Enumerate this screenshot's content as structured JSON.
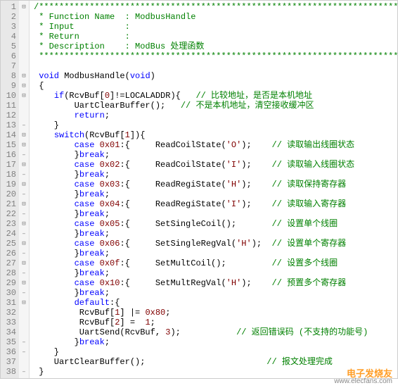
{
  "domain": "Computer-Use",
  "watermark": {
    "line1": "电子发烧友",
    "line2": "www.elecfans.com"
  },
  "line_numbers": {
    "start": 1,
    "end": 38
  },
  "fold_markers": {
    "1": "⊟",
    "8": "⊟",
    "9": "⊟",
    "10": "⊟",
    "13": "–",
    "14": "⊟",
    "15": "⊟",
    "16": "–",
    "17": "⊟",
    "18": "–",
    "19": "⊟",
    "20": "–",
    "21": "⊟",
    "22": "–",
    "23": "⊟",
    "24": "–",
    "25": "⊟",
    "26": "–",
    "27": "⊟",
    "28": "–",
    "29": "⊟",
    "30": "–",
    "31": "⊟",
    "35": "–",
    "36": "–",
    "38": "–"
  },
  "code": {
    "l1": "/****************************************************************************",
    "l2": " * Function Name  : ModbusHandle",
    "l3": " * Input          :",
    "l4": " * Return         :",
    "l5": " * Description    : ModBus 处理函数",
    "l6": " ***************************************************************************/",
    "l7": "",
    "l8_kw1": "void",
    "l8_name": " ModbusHandle(",
    "l8_kw2": "void",
    "l8_close": ")",
    "l9": "{",
    "l10_kw": "if",
    "l10_expr": "(RcvBuf[",
    "l10_n": "0",
    "l10_rest": "]!=LOCALADDR){   ",
    "l10_cmt": "// 比较地址，是否是本机地址",
    "l11_txt": "        UartClearBuffer();   ",
    "l11_cmt": "// 不是本机地址，清空接收缓冲区",
    "l12_kw": "return",
    "l12_rest": ";",
    "l13": "    }",
    "l14_kw": "switch",
    "l14_expr": "(RcvBuf[",
    "l14_n": "1",
    "l14_close": "]){",
    "l15_kw": "case",
    "l15_v": " 0x01",
    "l15_col": ":{     ReadCoilState(",
    "l15_s": "'O'",
    "l15_end": ");    ",
    "l15_cmt": "// 读取输出线圈状态",
    "l16_br": "break",
    "l16_txt": "        }",
    "l16_end": ";",
    "l17_kw": "case",
    "l17_v": " 0x02",
    "l17_col": ":{     ReadCoilState(",
    "l17_s": "'I'",
    "l17_end": ");    ",
    "l17_cmt": "// 读取输入线圈状态",
    "l18_br": "break",
    "l18_txt": "        }",
    "l18_end": ";",
    "l19_kw": "case",
    "l19_v": " 0x03",
    "l19_col": ":{     ReadRegiState(",
    "l19_s": "'H'",
    "l19_end": ");    ",
    "l19_cmt": "// 读取保持寄存器",
    "l20_br": "break",
    "l20_txt": "        }",
    "l20_end": ";",
    "l21_kw": "case",
    "l21_v": " 0x04",
    "l21_col": ":{     ReadRegiState(",
    "l21_s": "'I'",
    "l21_end": ");    ",
    "l21_cmt": "// 读取输入寄存器",
    "l22_br": "break",
    "l22_txt": "        }",
    "l22_end": ";",
    "l23_kw": "case",
    "l23_v": " 0x05",
    "l23_col": ":{     SetSingleCoil();       ",
    "l23_cmt": "// 设置单个线圈",
    "l24_br": "break",
    "l24_txt": "        }",
    "l24_end": ";",
    "l25_kw": "case",
    "l25_v": " 0x06",
    "l25_col": ":{     SetSingleRegVal(",
    "l25_s": "'H'",
    "l25_end": ");  ",
    "l25_cmt": "// 设置单个寄存器",
    "l26_br": "break",
    "l26_txt": "        }",
    "l26_end": ";",
    "l27_kw": "case",
    "l27_v": " 0x0f",
    "l27_col": ":{     SetMultCoil();         ",
    "l27_cmt": "// 设置多个线圈",
    "l28_br": "break",
    "l28_txt": "        }",
    "l28_end": ";",
    "l29_kw": "case",
    "l29_v": " 0x10",
    "l29_col": ":{     SetMultRegVal(",
    "l29_s": "'H'",
    "l29_end": ");    ",
    "l29_cmt": "// 预置多个寄存器",
    "l30_br": "break",
    "l30_txt": "        }",
    "l30_end": ";",
    "l31_kw": "default",
    "l31_rest": ":{",
    "l32_a": "         RcvBuf[",
    "l32_n1": "1",
    "l32_b": "] |= ",
    "l32_n2": "0x80",
    "l32_c": ";",
    "l33_a": "         RcvBuf[",
    "l33_n1": "2",
    "l33_b": "] =  ",
    "l33_n2": "1",
    "l33_c": ";",
    "l34_a": "         UartSend(RcvBuf, ",
    "l34_n": "3",
    "l34_b": ");           ",
    "l34_cmt": "// 返回错误码 (不支持的功能号)",
    "l35_br": "break",
    "l35_txt": "        }",
    "l35_end": ";",
    "l36": "    }",
    "l37_a": "    UartClearBuffer();                        ",
    "l37_cmt": "// 报文处理完成",
    "l38": "}"
  }
}
